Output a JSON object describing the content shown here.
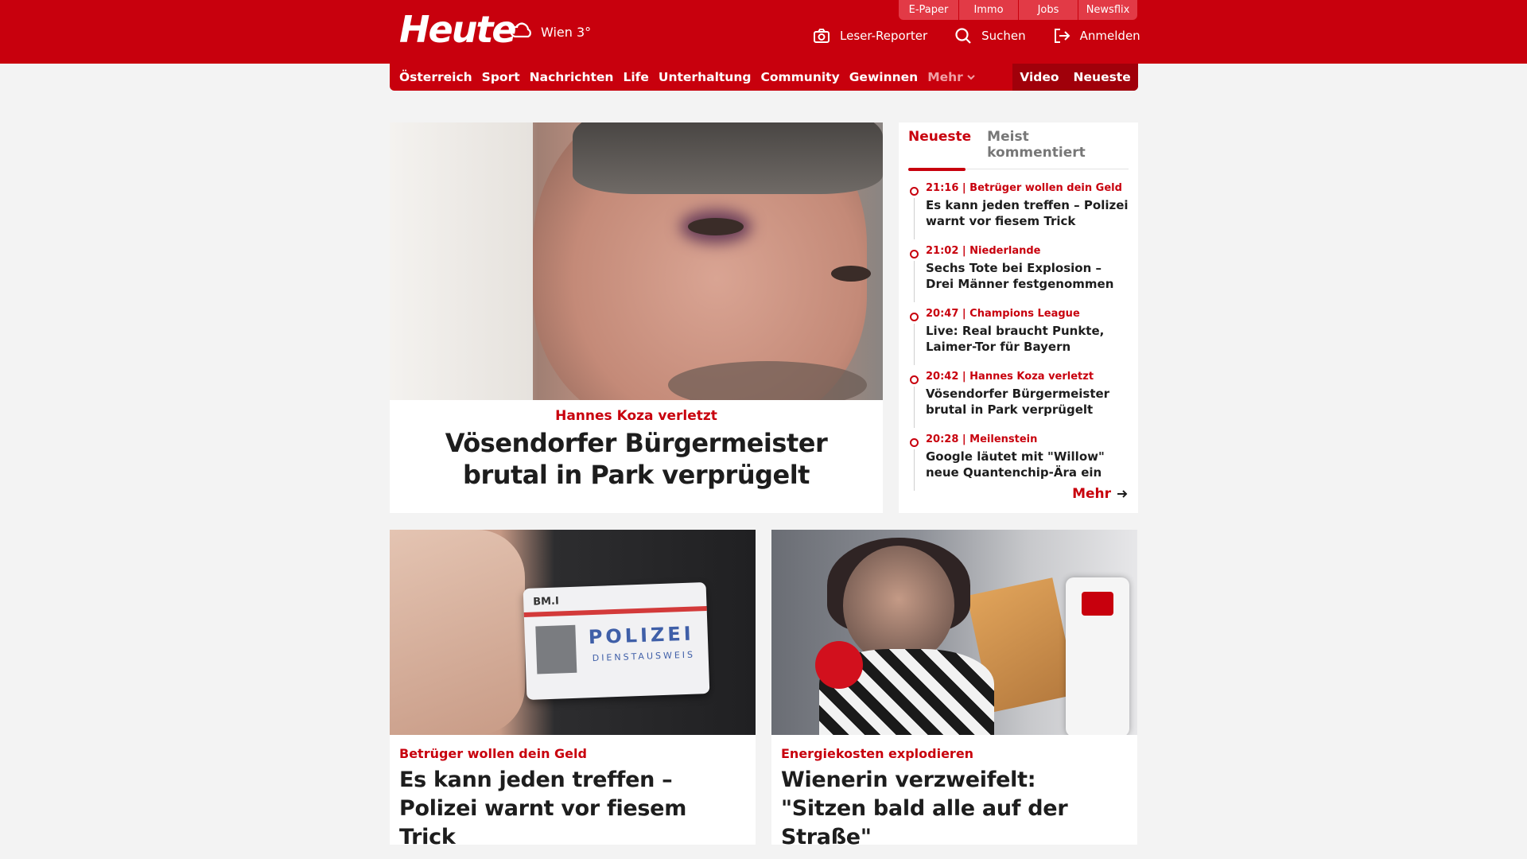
{
  "header": {
    "logo": "Heute",
    "weather": "Wien 3°",
    "service_tabs": [
      "E-Paper",
      "Immo",
      "Jobs",
      "Newsflix"
    ],
    "actions": {
      "reporter": "Leser-Reporter",
      "search": "Suchen",
      "login": "Anmelden"
    }
  },
  "nav": {
    "items": [
      "Österreich",
      "Sport",
      "Nachrichten",
      "Life",
      "Unterhaltung",
      "Community",
      "Gewinnen"
    ],
    "more": "Mehr",
    "right": [
      "Video",
      "Neueste"
    ]
  },
  "lead": {
    "kicker": "Hannes Koza verletzt",
    "title": "Vösendorfer Bürgermeister brutal in Park verprügelt"
  },
  "sidebar": {
    "tabs": [
      "Neueste",
      "Meist kommentiert"
    ],
    "items": [
      {
        "meta": "21:16 | Betrüger wollen dein Geld",
        "title": "Es kann jeden treffen – Polizei warnt vor fiesem Trick"
      },
      {
        "meta": "21:02 | Niederlande",
        "title": "Sechs Tote bei Explosion – Drei Männer festgenommen"
      },
      {
        "meta": "20:47 | Champions League",
        "title": "Live: Real braucht Punkte, Laimer-Tor für Bayern"
      },
      {
        "meta": "20:42 | Hannes Koza verletzt",
        "title": "Vösendorfer Bürgermeister brutal in Park verprügelt"
      },
      {
        "meta": "20:28 | Meilenstein",
        "title": "Google läutet mit \"Willow\" neue Quantenchip-Ära ein"
      }
    ],
    "more": "Mehr"
  },
  "cards": [
    {
      "kicker": "Betrüger wollen dein Geld",
      "title": "Es kann jeden treffen – Polizei warnt vor fiesem Trick",
      "image_text": {
        "bmi": "BM.I",
        "polizei": "POLIZEI",
        "dienstausweis": "DIENSTAUSWEIS"
      }
    },
    {
      "kicker": "Energiekosten explodieren",
      "title": "Wienerin verzweifelt: \"Sitzen bald alle auf der Straße\""
    }
  ],
  "colors": {
    "brand_red": "#c8000d",
    "dark_red": "#a0000a",
    "background": "#f3f3f3"
  }
}
